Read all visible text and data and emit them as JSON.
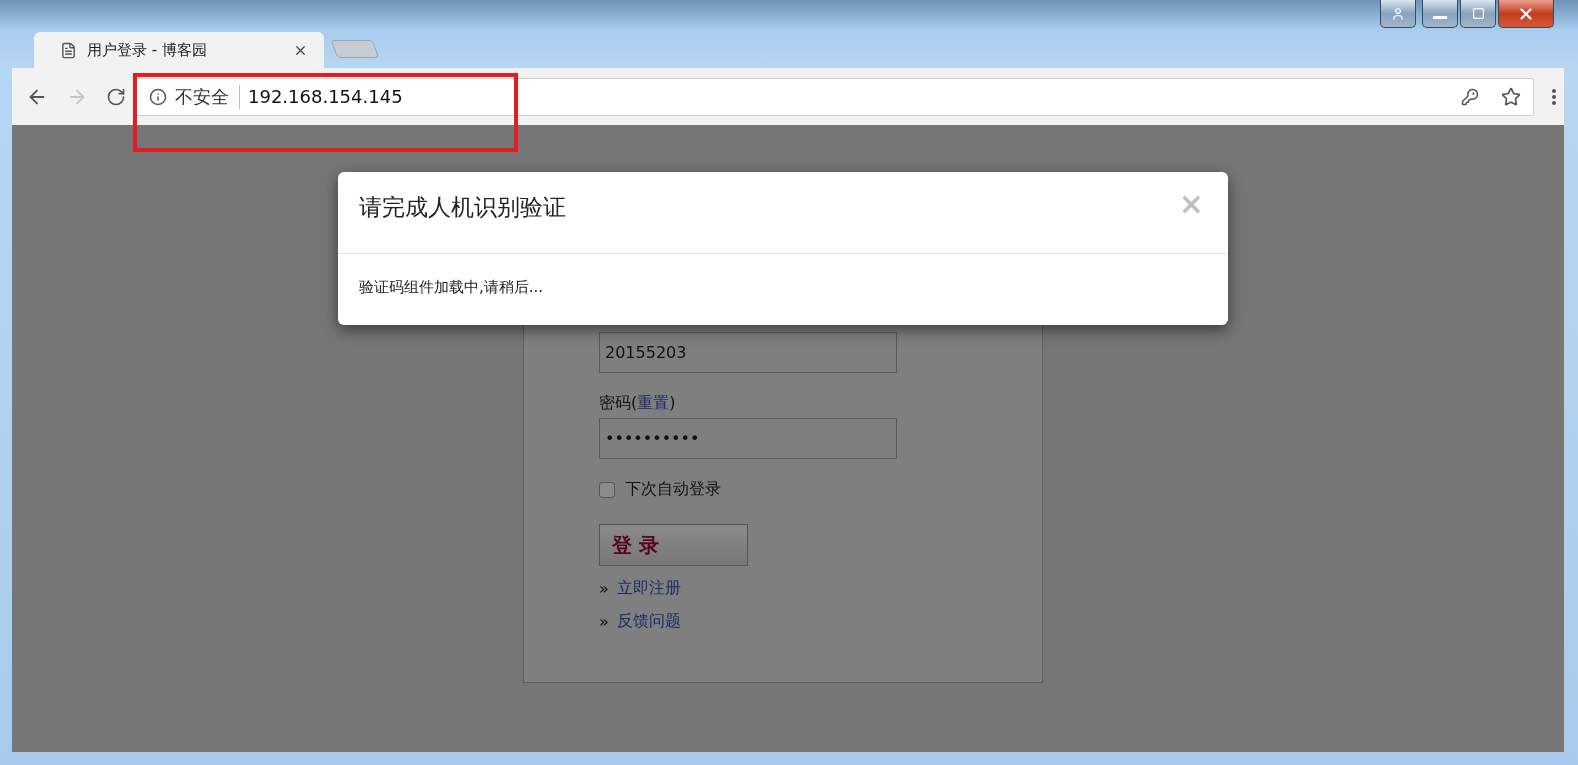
{
  "tabs": [
    {
      "title": "用户登录 - 博客园",
      "selected": true
    }
  ],
  "toolbar": {
    "back_disabled": false,
    "forward_disabled": true,
    "security_label": "不安全",
    "url": "192.168.154.145"
  },
  "login": {
    "username_value": "20155203",
    "password_label": "密码(",
    "password_link": "重置",
    "password_label_end": ")",
    "password_value": "••••••••••",
    "remember": {
      "label": "下次自动登录",
      "checked": false
    },
    "submit": "登 录",
    "links": [
      {
        "bullet": "»",
        "label": "立即注册"
      },
      {
        "bullet": "»",
        "label": "反馈问题"
      }
    ]
  },
  "dialog": {
    "title": "请完成人机识别验证",
    "close": "×",
    "message": "验证码组件加载中,请稍后..."
  }
}
